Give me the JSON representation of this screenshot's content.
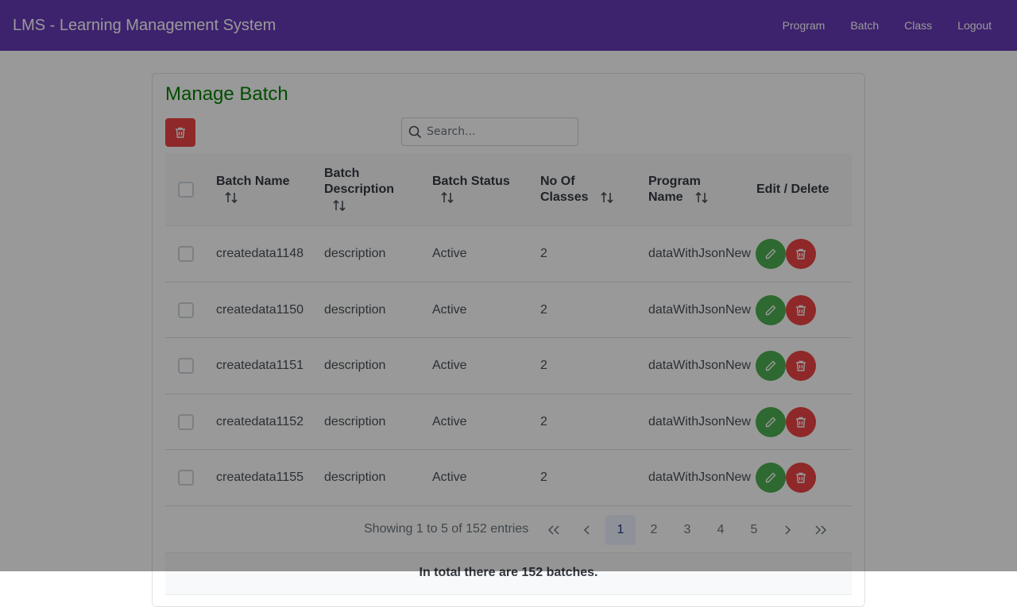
{
  "app": {
    "title": "LMS - Learning Management System"
  },
  "nav": {
    "items": [
      {
        "label": "Program"
      },
      {
        "label": "Batch"
      },
      {
        "label": "Class"
      },
      {
        "label": "Logout"
      }
    ]
  },
  "page": {
    "title": "Manage Batch"
  },
  "search": {
    "placeholder": "Search..."
  },
  "table": {
    "columns": {
      "batch_name": "Batch Name",
      "batch_description_line1": "Batch",
      "batch_description_line2": "Description",
      "batch_status": "Batch Status",
      "no_of_classes_line1": "No Of",
      "no_of_classes_line2": "Classes",
      "program_name_line1": "Program",
      "program_name_line2": "Name",
      "edit_delete": "Edit / Delete"
    },
    "rows": [
      {
        "name": "createdata1148",
        "description": "description",
        "status": "Active",
        "classes": "2",
        "program": "dataWithJsonNew"
      },
      {
        "name": "createdata1150",
        "description": "description",
        "status": "Active",
        "classes": "2",
        "program": "dataWithJsonNew"
      },
      {
        "name": "createdata1151",
        "description": "description",
        "status": "Active",
        "classes": "2",
        "program": "dataWithJsonNew"
      },
      {
        "name": "createdata1152",
        "description": "description",
        "status": "Active",
        "classes": "2",
        "program": "dataWithJsonNew"
      },
      {
        "name": "createdata1155",
        "description": "description",
        "status": "Active",
        "classes": "2",
        "program": "dataWithJsonNew"
      }
    ]
  },
  "pagination": {
    "showing": "Showing 1 to 5 of 152 entries",
    "pages": [
      "1",
      "2",
      "3",
      "4",
      "5"
    ],
    "current": "1"
  },
  "footer": {
    "summary": "In total there are 152 batches."
  },
  "colors": {
    "navbar": "#673ab7",
    "title": "#008000",
    "edit": "#4caf50",
    "delete": "#ef4444"
  }
}
